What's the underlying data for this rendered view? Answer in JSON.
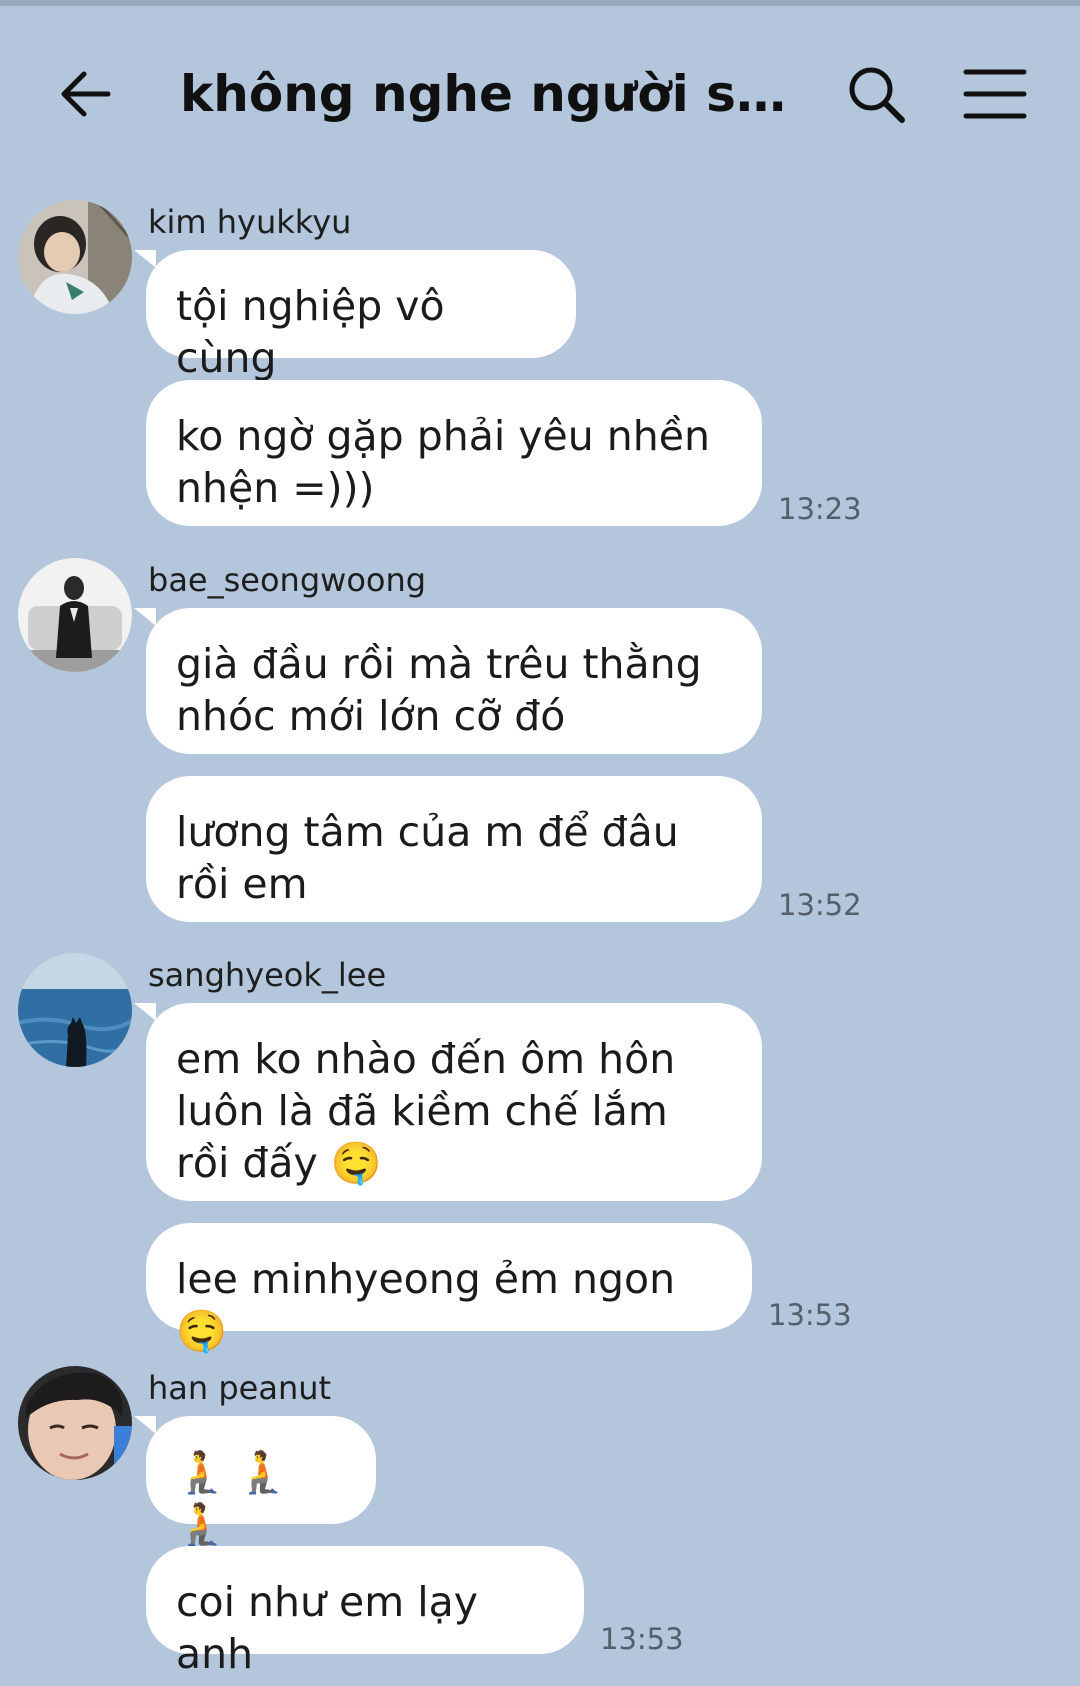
{
  "header": {
    "title": "không nghe người simp...",
    "back_icon": "arrow-left-icon",
    "search_icon": "search-icon",
    "menu_icon": "hamburger-menu-icon"
  },
  "messages": [
    {
      "sender": "kim hyukkyu",
      "bubbles": [
        "tội nghiệp vô cùng",
        "ko ngờ gặp phải yêu nhền nhện =)))"
      ],
      "time": "13:23"
    },
    {
      "sender": "bae_seongwoong",
      "bubbles": [
        "già đầu rồi mà trêu thằng nhóc mới lớn cỡ đó",
        "lương tâm của m để đâu rồi em"
      ],
      "time": "13:52"
    },
    {
      "sender": "sanghyeok_lee",
      "bubbles": [
        "em ko nhào đến ôm hôn luôn là đã kiềm chế lắm rồi đấy 🤤",
        "lee minhyeong ẻm ngon 🤤"
      ],
      "time": "13:53"
    },
    {
      "sender": "han peanut",
      "bubbles": [
        "🧎🧎🧎",
        "coi như em lạy anh"
      ],
      "time": "13:53"
    }
  ],
  "colors": {
    "background": "#b3c6dc",
    "bubble": "#ffffff",
    "timestamp": "#565e6a"
  }
}
